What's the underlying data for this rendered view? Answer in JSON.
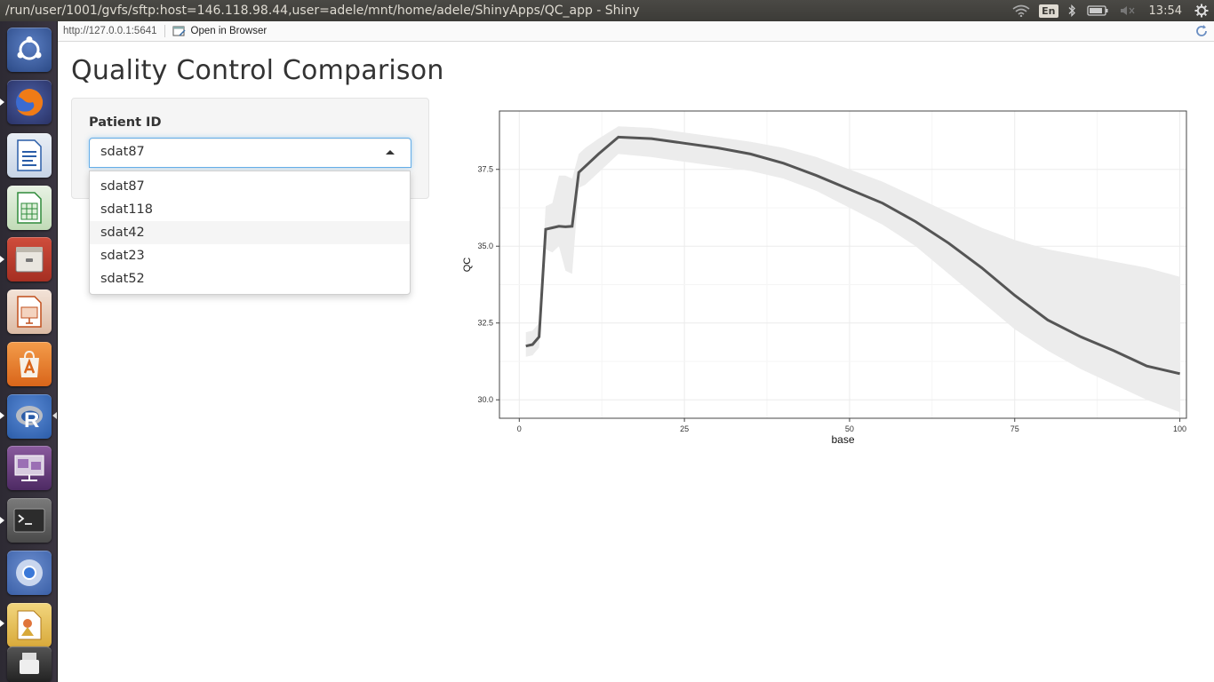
{
  "window": {
    "title": "/run/user/1001/gvfs/sftp:host=146.118.98.44,user=adele/mnt/home/adele/ShinyApps/QC_app - Shiny",
    "keyboard_layout": "En",
    "clock": "13:54"
  },
  "viewer": {
    "url": "http://127.0.0.1:5641",
    "open_in_browser": "Open in Browser"
  },
  "app": {
    "title": "Quality Control Comparison",
    "patient_label": "Patient ID",
    "selected_patient": "sdat87",
    "options": [
      "sdat87",
      "sdat118",
      "sdat42",
      "sdat23",
      "sdat52"
    ],
    "highlighted_option": "sdat42"
  },
  "launcher": {
    "items": [
      "ubuntu-dash-icon",
      "firefox-icon",
      "libreoffice-writer-icon",
      "libreoffice-calc-icon",
      "file-archive-icon",
      "libreoffice-impress-icon",
      "software-center-icon",
      "r-icon",
      "remote-desktop-icon",
      "terminal-icon",
      "chromium-icon",
      "image-viewer-icon",
      "usb-drive-icon"
    ]
  },
  "chart_data": {
    "type": "line",
    "xlabel": "base",
    "ylabel": "QC",
    "xlim": [
      -3,
      101
    ],
    "ylim": [
      29.4,
      39.4
    ],
    "xticks": [
      0,
      25,
      50,
      75,
      100
    ],
    "yticks": [
      30.0,
      32.5,
      35.0,
      37.5
    ],
    "ytick_labels": [
      "30.0",
      "32.5",
      "35.0",
      "37.5"
    ],
    "grid": true,
    "series": [
      {
        "x": [
          1,
          2,
          3,
          4,
          5,
          6,
          7,
          8,
          9,
          10,
          12,
          15,
          20,
          25,
          30,
          35,
          40,
          45,
          50,
          55,
          60,
          65,
          70,
          75,
          80,
          85,
          90,
          95,
          100
        ],
        "y": [
          31.75,
          31.8,
          32.05,
          35.55,
          35.6,
          35.65,
          35.63,
          35.65,
          37.4,
          37.6,
          38.0,
          38.55,
          38.5,
          38.35,
          38.2,
          38.0,
          37.7,
          37.3,
          36.85,
          36.4,
          35.8,
          35.1,
          34.3,
          33.4,
          32.6,
          32.05,
          31.6,
          31.1,
          30.85
        ],
        "band_upper": [
          32.2,
          32.25,
          32.5,
          36.3,
          36.4,
          37.3,
          37.3,
          37.2,
          38.0,
          38.2,
          38.5,
          38.9,
          38.85,
          38.7,
          38.55,
          38.4,
          38.2,
          37.9,
          37.5,
          37.1,
          36.6,
          36.1,
          35.6,
          35.2,
          34.9,
          34.7,
          34.5,
          34.3,
          34.0
        ],
        "band_lower": [
          31.4,
          31.45,
          31.7,
          34.9,
          34.8,
          35.0,
          34.2,
          34.1,
          36.9,
          37.0,
          37.4,
          38.0,
          37.9,
          37.75,
          37.6,
          37.45,
          37.2,
          36.8,
          36.25,
          35.7,
          35.0,
          34.1,
          33.2,
          32.3,
          31.6,
          31.0,
          30.5,
          30.0,
          29.6
        ]
      }
    ]
  }
}
